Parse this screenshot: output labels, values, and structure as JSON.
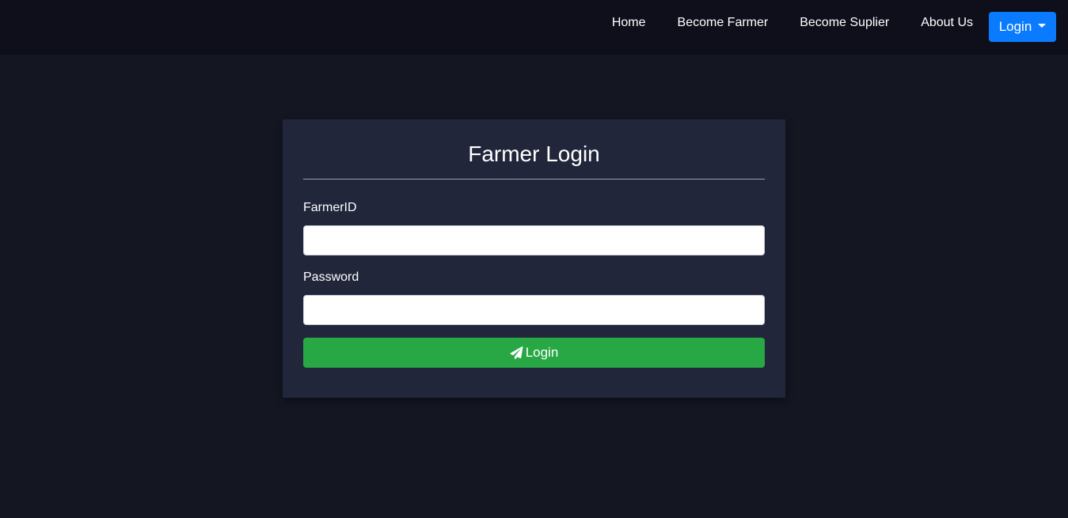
{
  "navbar": {
    "links": [
      "Home",
      "Become Farmer",
      "Become Suplier",
      "About Us"
    ],
    "login_dropdown": "Login"
  },
  "card": {
    "title": "Farmer Login",
    "farmer_id_label": "FarmerID",
    "farmer_id_value": "",
    "password_label": "Password",
    "password_value": "",
    "submit_label": "Login",
    "submit_icon": "paper-plane-icon"
  },
  "colors": {
    "background": "#141622",
    "navbar": "#0e0f1b",
    "card": "#21263b",
    "primary": "#0a7bff",
    "success": "#28a745"
  }
}
